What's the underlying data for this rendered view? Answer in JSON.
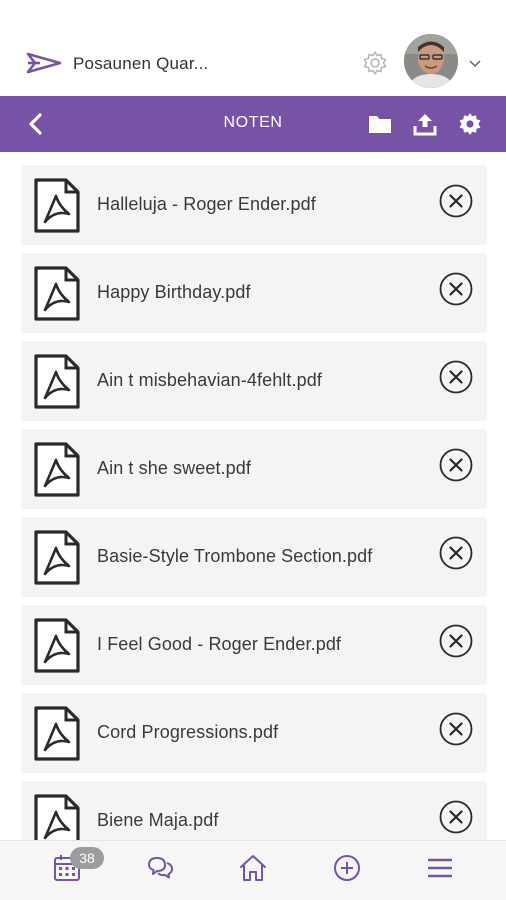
{
  "header": {
    "team_name": "Posaunen Quar...",
    "logo_icon": "brand-arrow-icon",
    "settings_icon": "gear-outline-icon",
    "avatar": "user-avatar",
    "menu_icon": "chevron-down-icon"
  },
  "toolbar": {
    "title": "NOTEN",
    "back_icon": "chevron-left-icon",
    "actions": [
      "folder-icon",
      "upload-icon",
      "gear-icon"
    ]
  },
  "files": [
    {
      "name": "Halleluja - Roger Ender.pdf"
    },
    {
      "name": "Happy Birthday.pdf"
    },
    {
      "name": "Ain t misbehavian-4fehlt.pdf"
    },
    {
      "name": "Ain t she sweet.pdf"
    },
    {
      "name": "Basie-Style Trombone Section.pdf"
    },
    {
      "name": "I Feel Good - Roger Ender.pdf"
    },
    {
      "name": "Cord Progressions.pdf"
    },
    {
      "name": "Biene Maja.pdf"
    }
  ],
  "bottom_nav": {
    "badge": "38",
    "items": [
      "calendar-icon",
      "chat-icon",
      "home-icon",
      "add-circle-icon",
      "menu-icon"
    ]
  },
  "colors": {
    "accent": "#7653a7",
    "item_background": "#f4f4f4",
    "badge": "#9c9c9c"
  }
}
